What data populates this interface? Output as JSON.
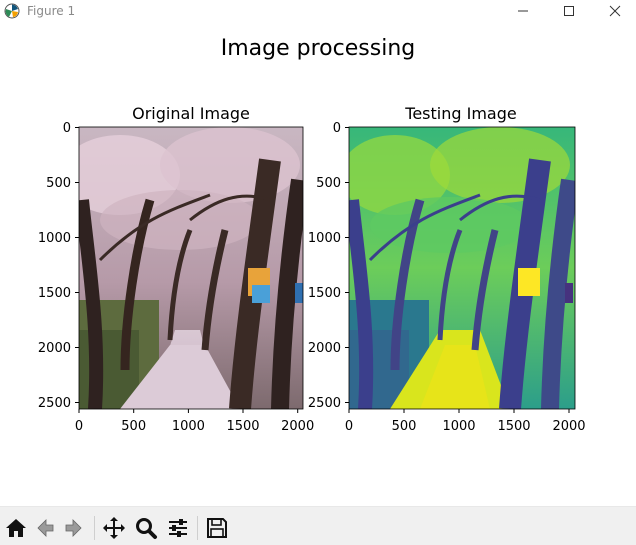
{
  "window": {
    "title": "Figure 1",
    "icon": "matplotlib-icon",
    "controls": [
      "minimize-icon",
      "maximize-icon",
      "close-icon"
    ]
  },
  "figure": {
    "suptitle": "Image processing",
    "subplots": [
      {
        "title": "Original Image",
        "xticks": [
          "0",
          "500",
          "1000",
          "1500",
          "2000"
        ],
        "yticks": [
          "0",
          "500",
          "1000",
          "1500",
          "2000",
          "2500"
        ],
        "xlim": [
          0,
          2048
        ],
        "ylim": [
          2560,
          0
        ],
        "colormap": "rgb photo (cherry blossom path)"
      },
      {
        "title": "Testing Image",
        "xticks": [
          "0",
          "500",
          "1000",
          "1500",
          "2000"
        ],
        "yticks": [
          "0",
          "500",
          "1000",
          "1500",
          "2000",
          "2500"
        ],
        "xlim": [
          0,
          2048
        ],
        "ylim": [
          2560,
          0
        ],
        "colormap": "viridis"
      }
    ]
  },
  "toolbar": {
    "buttons": [
      "home-icon",
      "back-icon",
      "forward-icon",
      "pan-icon",
      "zoom-icon",
      "configure-subplots-icon",
      "save-icon"
    ]
  },
  "colors": {
    "viridis_dark": "#3b3f8c",
    "viridis_mid": "#23a884",
    "viridis_light": "#d9e51d",
    "blossom": "#d8b9c4",
    "trunk": "#3a2a25",
    "toolbar_bg": "#f0f0f0"
  }
}
